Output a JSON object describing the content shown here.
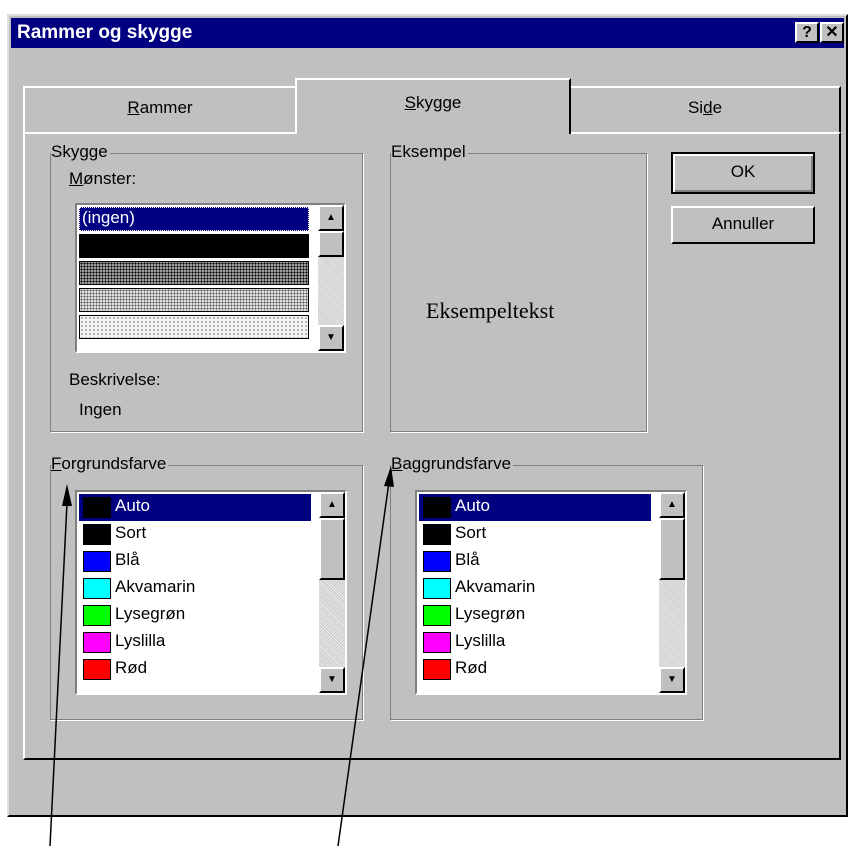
{
  "window": {
    "title": "Rammer og skygge",
    "help_label": "?",
    "close_label": "✕"
  },
  "tabs": [
    {
      "label": "Rammer",
      "mnemonic": "R",
      "rest": "ammer",
      "active": false
    },
    {
      "label": "Skygge",
      "mnemonic": "S",
      "rest": "kygge",
      "active": true
    },
    {
      "pre": "Si",
      "mnemonic": "d",
      "rest": "e",
      "label": "Side",
      "active": false
    }
  ],
  "shading": {
    "legend": "Skygge",
    "pattern_label_mn": "M",
    "pattern_label_rest": "ønster:",
    "patterns": [
      "(ingen)",
      "solid",
      "dark-dots",
      "light-dots",
      "fine-dots"
    ],
    "description_label": "Beskrivelse:",
    "description_value": "Ingen"
  },
  "sample": {
    "legend": "Eksempel",
    "text": "Eksempeltekst"
  },
  "foreground": {
    "legend_mn": "F",
    "legend_rest": "orgrundsfarve",
    "legend": "Forgrundsfarve",
    "selected": "Auto"
  },
  "background": {
    "legend_mn": "B",
    "legend_rest": "aggrundsfarve",
    "legend": "Baggrundsfarve",
    "selected": "Auto"
  },
  "colors": [
    {
      "name": "Auto",
      "hex": "#000000"
    },
    {
      "name": "Sort",
      "hex": "#000000"
    },
    {
      "name": "Blå",
      "hex": "#0000ff"
    },
    {
      "name": "Akvamarin",
      "hex": "#00ffff"
    },
    {
      "name": "Lysegrøn",
      "hex": "#00ff00"
    },
    {
      "name": "Lyslilla",
      "hex": "#ff00ff"
    },
    {
      "name": "Rød",
      "hex": "#ff0000"
    }
  ],
  "buttons": {
    "ok": "OK",
    "cancel": "Annuller"
  },
  "scroll_icons": {
    "up": "▲",
    "down": "▼"
  },
  "accent": "#000080"
}
